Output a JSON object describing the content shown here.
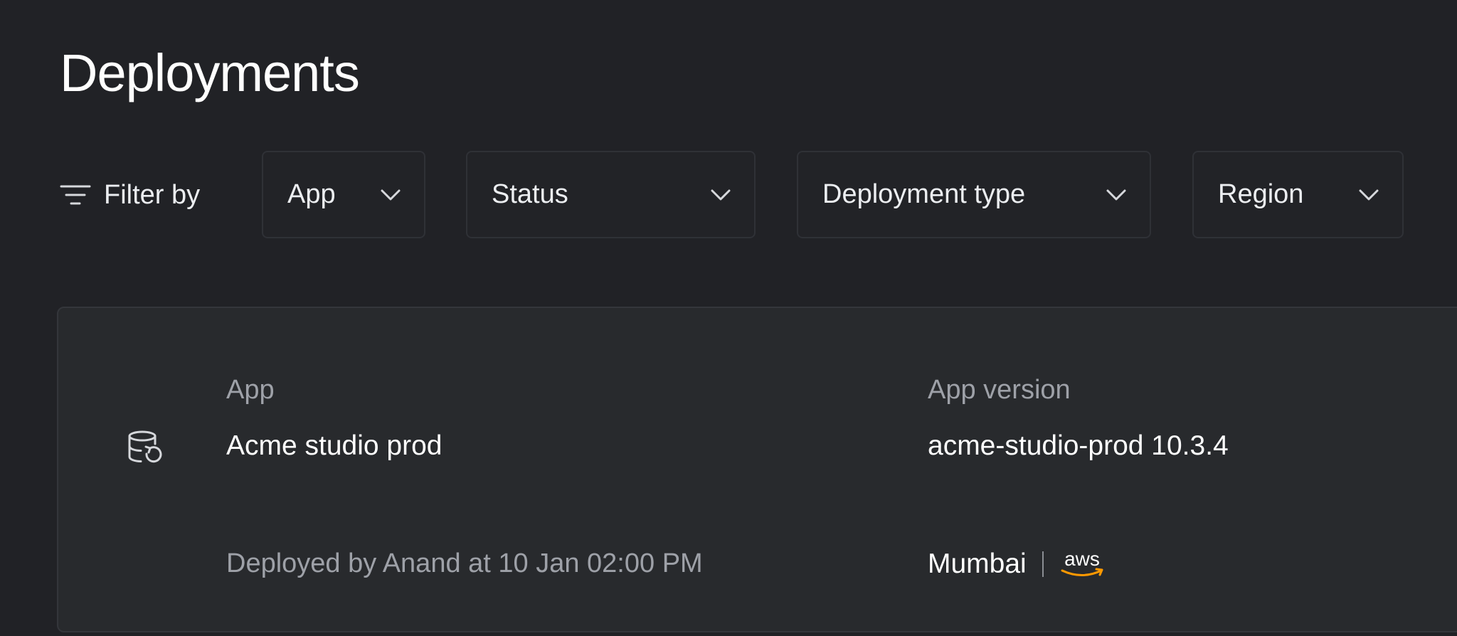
{
  "page": {
    "title": "Deployments"
  },
  "filters": {
    "label": "Filter by",
    "icon": "filter-icon",
    "dropdowns": [
      {
        "label": "App"
      },
      {
        "label": "Status"
      },
      {
        "label": "Deployment type"
      },
      {
        "label": "Region"
      }
    ]
  },
  "deployment": {
    "icon": "database-restore-icon",
    "app_label": "App",
    "app_value": "Acme studio prod",
    "version_label": "App version",
    "version_value": "acme-studio-prod 10.3.4",
    "deployed_text": "Deployed by Anand at 10 Jan 02:00 PM",
    "region": "Mumbai",
    "provider": "aws",
    "provider_accent": "#ff9900"
  },
  "colors": {
    "background": "#212226",
    "card": "#282a2d",
    "muted_text": "#9ea1a8"
  }
}
